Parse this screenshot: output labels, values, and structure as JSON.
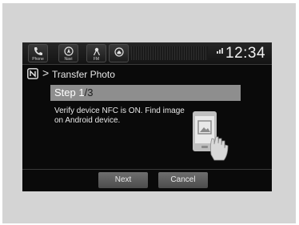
{
  "status_bar": {
    "buttons": [
      {
        "label": "Phone",
        "icon": "phone-icon"
      },
      {
        "label": "Navi",
        "icon": "navi-icon"
      },
      {
        "label": "FM",
        "icon": "fm-icon"
      },
      {
        "label": "",
        "icon": "home-icon"
      }
    ],
    "clock": "12:34"
  },
  "header": {
    "icon": "nfc-icon",
    "separator": ">",
    "title": "Transfer Photo"
  },
  "step": {
    "current": "Step 1",
    "total": "/3"
  },
  "instructions": "Verify device NFC is ON. Find image on Android device.",
  "illustration": {
    "icon": "phone-hand-icon"
  },
  "actions": {
    "next": "Next",
    "cancel": "Cancel"
  },
  "colors": {
    "screen_bg": "#0a0a0a",
    "step_bar": "#8e8e8e",
    "button": "#5c5c5c",
    "frame": "#d4d4d4"
  }
}
